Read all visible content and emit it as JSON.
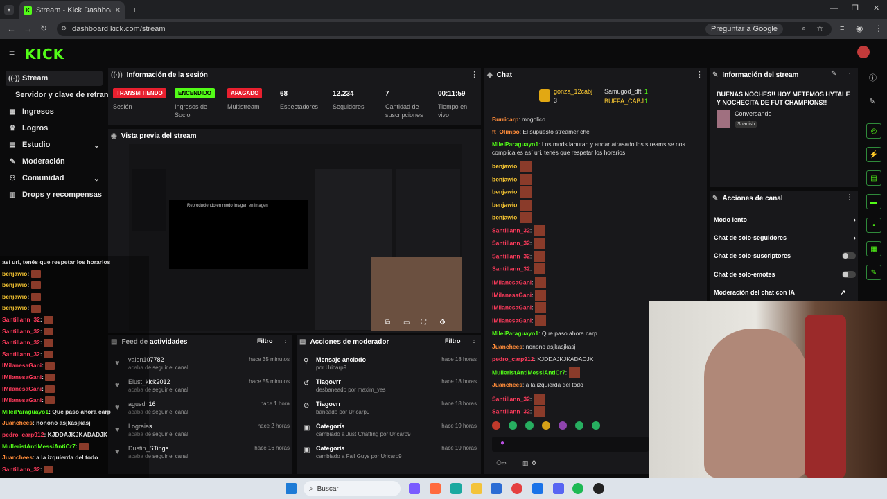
{
  "browser": {
    "tab_title": "Stream - Kick Dashboard",
    "url": "dashboard.kick.com/stream",
    "google_btn": "Preguntar a Google"
  },
  "app": {
    "logo": "KICK"
  },
  "sidebar": {
    "items": [
      {
        "label": "Stream",
        "icon": "broadcast-icon"
      },
      {
        "label": "Servidor y clave de retransm",
        "icon": ""
      },
      {
        "label": "Ingresos",
        "icon": "chart-icon"
      },
      {
        "label": "Logros",
        "icon": "trophy-icon"
      },
      {
        "label": "Estudio",
        "icon": "grid-icon"
      },
      {
        "label": "Moderación",
        "icon": "wrench-icon"
      },
      {
        "label": "Comunidad",
        "icon": "people-icon"
      },
      {
        "label": "Drops y recompensas",
        "icon": "gift-icon"
      }
    ]
  },
  "session": {
    "title": "Información de la sesión",
    "stats": [
      {
        "badge": "TRANSMITIENDO",
        "label": "Sesión"
      },
      {
        "badge": "ENCENDIDO",
        "label": "Ingresos de Socio"
      },
      {
        "badge": "APAGADO",
        "label": "Multistream"
      },
      {
        "value": "68",
        "label": "Espectadores"
      },
      {
        "value": "12.234",
        "label": "Seguidores"
      },
      {
        "value": "7",
        "label": "Cantidad de suscripciones"
      },
      {
        "value": "00:11:59",
        "label": "Tiempo en vivo"
      }
    ]
  },
  "preview": {
    "title": "Vista previa del stream",
    "pip_text": "Reproduciendo en modo imagen en imagen"
  },
  "feed": {
    "title": "Feed de actividades",
    "filter": "Filtro",
    "rows": [
      {
        "name": "valen107782",
        "sub": "acaba de seguir el canal",
        "time": "hace 35 minutos"
      },
      {
        "name": "Elust_kick2012",
        "sub": "acaba de seguir el canal",
        "time": "hace 55 minutos"
      },
      {
        "name": "agusdri16",
        "sub": "acaba de seguir el canal",
        "time": "hace 1 hora"
      },
      {
        "name": "Lograias",
        "sub": "acaba de seguir el canal",
        "time": "hace 2 horas"
      },
      {
        "name": "Dustin_STings",
        "sub": "acaba de seguir el canal",
        "time": "hace 16 horas"
      }
    ]
  },
  "modactions": {
    "title": "Acciones de moderador",
    "filter": "Filtro",
    "rows": [
      {
        "name": "Mensaje anclado",
        "sub": "por Uricarp9",
        "time": "hace 18 horas"
      },
      {
        "name": "Tiagovrr",
        "sub": "desbaneado por maxim_yes",
        "time": "hace 18 horas"
      },
      {
        "name": "Tiagovrr",
        "sub": "baneado por Uricarp9",
        "time": "hace 18 horas"
      },
      {
        "name": "Categoría",
        "sub": "cambiado a Just Chatting por Uricarp9",
        "time": "hace 19 horas"
      },
      {
        "name": "Categoría",
        "sub": "cambiado a Fall Guys por Uricarp9",
        "time": "hace 19 horas"
      }
    ]
  },
  "chat": {
    "title": "Chat",
    "top": [
      {
        "name": "gonza_12cabj",
        "count": "3"
      },
      {
        "name": "Samugod_dft",
        "count": "1"
      },
      {
        "name": "BUFFA_CABJ",
        "count": "1"
      }
    ],
    "lines": [
      {
        "user": "Burricarp",
        "text": ": mogolico",
        "color": "#ff8c3a"
      },
      {
        "user": "ft_Olimpo",
        "text": ": El supuesto streamer che",
        "color": "#ff8c3a"
      },
      {
        "user": "MileiParaguayo1",
        "text": ": Los mods laburan y andar atrasado los streams se nos complica es así uri, tenés que respetar los horarios",
        "color": "#53fc18"
      },
      {
        "user": "benjawio",
        "text": ":",
        "color": "#ffcc33"
      },
      {
        "user": "benjawio",
        "text": ":",
        "color": "#ffcc33"
      },
      {
        "user": "benjawio",
        "text": ":",
        "color": "#ffcc33"
      },
      {
        "user": "benjawio",
        "text": ":",
        "color": "#ffcc33"
      },
      {
        "user": "benjawio",
        "text": ":",
        "color": "#ffcc33"
      },
      {
        "user": "Santillann_32",
        "text": ":",
        "color": "#ff3b5c"
      },
      {
        "user": "Santillann_32",
        "text": ":",
        "color": "#ff3b5c"
      },
      {
        "user": "Santillann_32",
        "text": ":",
        "color": "#ff3b5c"
      },
      {
        "user": "Santillann_32",
        "text": ":",
        "color": "#ff3b5c"
      },
      {
        "user": "IMilanesaGani",
        "text": ":",
        "color": "#ff3b5c"
      },
      {
        "user": "IMilanesaGani",
        "text": ":",
        "color": "#ff3b5c"
      },
      {
        "user": "IMilanesaGani",
        "text": ":",
        "color": "#ff3b5c"
      },
      {
        "user": "IMilanesaGani",
        "text": ":",
        "color": "#ff3b5c"
      },
      {
        "user": "MileiParaguayo1",
        "text": ": Que paso ahora carp",
        "color": "#53fc18"
      },
      {
        "user": "Juanchees",
        "text": ": nonono asjkasjkasj",
        "color": "#ff8c3a"
      },
      {
        "user": "pedro_carp912",
        "text": ": KJDDAJKJKADADJK",
        "color": "#ff3b5c"
      },
      {
        "user": "MulleristAntiMessiAntiCr7",
        "text": ":",
        "color": "#53fc18"
      },
      {
        "user": "Juanchees",
        "text": ": a la izquierda del todo",
        "color": "#ff8c3a"
      },
      {
        "user": "Santillann_32",
        "text": ":",
        "color": "#ff3b5c"
      },
      {
        "user": "Santillann_32",
        "text": ":",
        "color": "#ff3b5c"
      }
    ],
    "footer_count": "0"
  },
  "overlay": {
    "lines": [
      {
        "user": "",
        "text": "así uri, tenés que respetar los horarios",
        "color": "#ddd"
      },
      {
        "user": "benjawio",
        "text": ":",
        "color": "#ffcc33"
      },
      {
        "user": "benjawio",
        "text": ":",
        "color": "#ffcc33"
      },
      {
        "user": "benjawio",
        "text": ":",
        "color": "#ffcc33"
      },
      {
        "user": "benjawio",
        "text": ":",
        "color": "#ffcc33"
      },
      {
        "user": "Santillann_32",
        "text": ":",
        "color": "#ff3b5c"
      },
      {
        "user": "Santillann_32",
        "text": ":",
        "color": "#ff3b5c"
      },
      {
        "user": "Santillann_32",
        "text": ":",
        "color": "#ff3b5c"
      },
      {
        "user": "Santillann_32",
        "text": ":",
        "color": "#ff3b5c"
      },
      {
        "user": "IMilanesaGani",
        "text": ":",
        "color": "#ff3b5c"
      },
      {
        "user": "IMilanesaGani",
        "text": ":",
        "color": "#ff3b5c"
      },
      {
        "user": "IMilanesaGani",
        "text": ":",
        "color": "#ff3b5c"
      },
      {
        "user": "IMilanesaGani",
        "text": ":",
        "color": "#ff3b5c"
      },
      {
        "user": "MileiParaguayo1",
        "text": ": Que paso ahora carp",
        "color": "#53fc18"
      },
      {
        "user": "Juanchees",
        "text": ": nonono asjkasjkasj",
        "color": "#ff8c3a"
      },
      {
        "user": "pedro_carp912",
        "text": ": KJDDAJKJKADADJK",
        "color": "#ff3b5c"
      },
      {
        "user": "MulleristAntiMessiAntiCr7",
        "text": ":",
        "color": "#53fc18"
      },
      {
        "user": "Juanchees",
        "text": ": a la izquierda del todo",
        "color": "#ff8c3a"
      },
      {
        "user": "Santillann_32",
        "text": ":",
        "color": "#ff3b5c"
      },
      {
        "user": "Santillann_32",
        "text": ":",
        "color": "#ff3b5c"
      }
    ]
  },
  "streaminfo": {
    "title": "Información del stream",
    "stream_title": "BUENAS NOCHES!! HOY METEMOS HYTALE Y NOCHECITA DE FUT CHAMPIONS!!",
    "category": "Conversando",
    "language": "Spanish"
  },
  "channel_actions": {
    "title": "Acciones de canal",
    "rows": [
      {
        "label": "Modo lento",
        "type": "chevron"
      },
      {
        "label": "Chat de solo-seguidores",
        "type": "chevron"
      },
      {
        "label": "Chat de solo-suscriptores",
        "type": "toggle"
      },
      {
        "label": "Chat de solo-emotes",
        "type": "toggle"
      },
      {
        "label": "Moderación del chat con IA",
        "type": "link"
      }
    ]
  },
  "taskbar": {
    "search": "Buscar"
  },
  "colors": {
    "accent": "#53fc18",
    "live": "#e8202f",
    "on": "#53fc18",
    "off": "#e8202f"
  }
}
